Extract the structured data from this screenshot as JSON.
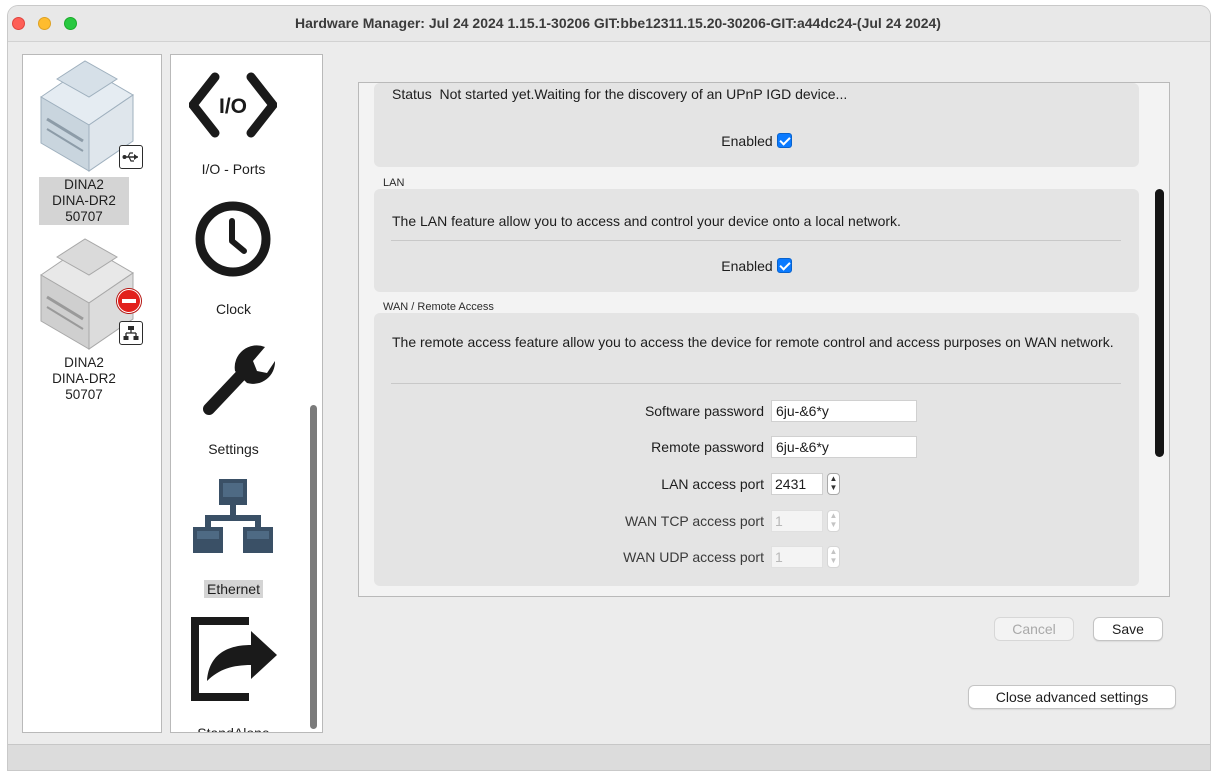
{
  "window": {
    "title": "Hardware Manager: Jul 24 2024 1.15.1-30206 GIT:bbe12311.15.20-30206-GIT:a44dc24-(Jul 24 2024)"
  },
  "devices": [
    {
      "name": "DINA2",
      "model": "DINA-DR2",
      "serial": "50707",
      "connection_icon": "usb-icon",
      "selected": true
    },
    {
      "name": "DINA2",
      "model": "DINA-DR2",
      "serial": "50707",
      "connection_icon": "network-icon",
      "status_icon": "no-entry-icon",
      "selected": false
    }
  ],
  "nav": {
    "items": [
      {
        "label": "I/O - Ports",
        "icon": "io-ports-icon"
      },
      {
        "label": "Clock",
        "icon": "clock-icon"
      },
      {
        "label": "Settings",
        "icon": "wrench-icon"
      },
      {
        "label": "Ethernet",
        "icon": "network-icon",
        "selected": true
      },
      {
        "label": "StandAlone",
        "icon": "export-arrow-icon"
      }
    ]
  },
  "upnp": {
    "status_label": "Status",
    "status_text": "Not started yet.Waiting for the discovery of an UPnP IGD device...",
    "enabled_label": "Enabled",
    "enabled": true
  },
  "lan": {
    "title": "LAN",
    "description": "The LAN feature allow you to access and control your device onto a local network.",
    "enabled_label": "Enabled",
    "enabled": true
  },
  "wan": {
    "title": "WAN / Remote Access",
    "description": "The remote access feature allow you to access the device for remote control and access purposes on WAN network.",
    "fields": {
      "software_password": {
        "label": "Software password",
        "value": "6ju-&6*y"
      },
      "remote_password": {
        "label": "Remote password",
        "value": "6ju-&6*y"
      },
      "lan_port": {
        "label": "LAN access port",
        "value": "2431"
      },
      "wan_tcp_port": {
        "label": "WAN TCP access port",
        "value": "1",
        "disabled": true
      },
      "wan_udp_port": {
        "label": "WAN UDP access port",
        "value": "1",
        "disabled": true
      }
    }
  },
  "buttons": {
    "cancel": "Cancel",
    "save": "Save",
    "close_advanced": "Close advanced settings"
  },
  "colors": {
    "accent": "#0a7aff",
    "icon_dark": "#1a1a1a",
    "network_icon": "#3a5066",
    "error_red": "#e2211c"
  }
}
